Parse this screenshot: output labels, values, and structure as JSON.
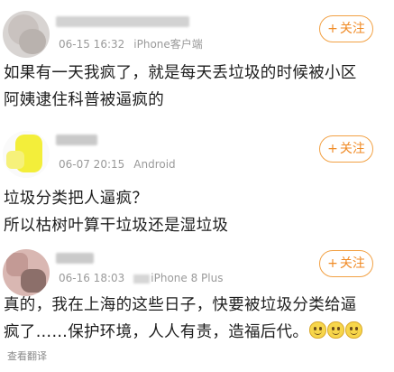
{
  "posts": [
    {
      "time": "06-15 16:32",
      "client": "iPhone客户端",
      "follow_label": "关注",
      "content_lines": [
        "如果有一天我疯了，就是每天丢垃圾的时候被小区",
        "阿姨逮住科普被逼疯的"
      ]
    },
    {
      "time": "06-07 20:15",
      "client": "Android",
      "follow_label": "关注",
      "content_lines": [
        "垃圾分类把人逼疯？",
        "所以枯树叶算干垃圾还是湿垃圾"
      ]
    },
    {
      "time": "06-16 18:03",
      "client": "iPhone 8 Plus",
      "follow_label": "关注",
      "content_lines": [
        "真的，我在上海的这些日子，快要被垃圾分类给逼",
        "疯了……保护环境，人人有责，造福后代。"
      ],
      "emoji": [
        "smile-emoji",
        "smile-emoji",
        "smile-emoji"
      ],
      "translate_label": "查看翻译"
    }
  ],
  "icons": {
    "follow": "plus-icon"
  },
  "colors": {
    "accent": "#f08a24",
    "meta_text": "#9a9a9a",
    "content_text": "#1e1e1e"
  }
}
